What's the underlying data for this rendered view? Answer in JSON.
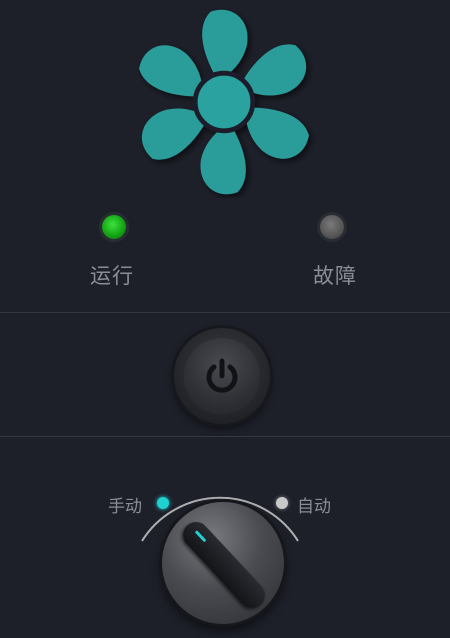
{
  "status": {
    "run_label": "运行",
    "fault_label": "故障"
  },
  "mode": {
    "manual_label": "手动",
    "auto_label": "自动",
    "selected": "手动"
  },
  "colors": {
    "background": "#1d1f29",
    "fan": "#2a9d9a",
    "run_lamp": "#1faa1f",
    "fault_lamp": "#555555",
    "mode_accent": "#1fd1d1",
    "label_text": "#8a8d96"
  },
  "icons": {
    "fan": "fan-icon",
    "power": "power-icon"
  }
}
